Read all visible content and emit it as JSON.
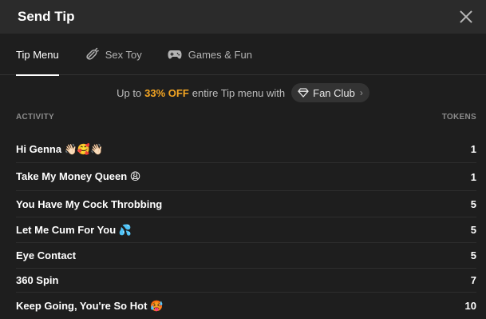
{
  "header": {
    "title": "Send Tip",
    "close_icon": "close-icon"
  },
  "tabs": [
    {
      "label": "Tip Menu",
      "icon": "",
      "active": true
    },
    {
      "label": "Sex Toy",
      "icon": "toy-icon",
      "active": false
    },
    {
      "label": "Games & Fun",
      "icon": "gamepad-icon",
      "active": false
    }
  ],
  "promo": {
    "prefix": "Up to",
    "highlight": "33% OFF",
    "suffix": "entire Tip menu with",
    "fanclub_label": "Fan Club",
    "accent_color": "#f5a623"
  },
  "columns": {
    "activity": "ACTIVITY",
    "tokens": "TOKENS"
  },
  "items": [
    {
      "label": "Hi Genna 👋🏻🥰👋🏻",
      "tokens": "1"
    },
    {
      "label": "Take My Money Queen 😩",
      "tokens": "1"
    },
    {
      "label": "You Have My Cock Throbbing",
      "tokens": "5"
    },
    {
      "label": "Let Me Cum For You 💦",
      "tokens": "5"
    },
    {
      "label": "Eye Contact",
      "tokens": "5"
    },
    {
      "label": "360 Spin",
      "tokens": "7"
    },
    {
      "label": "Keep Going, You're So Hot 🥵",
      "tokens": "10"
    }
  ]
}
